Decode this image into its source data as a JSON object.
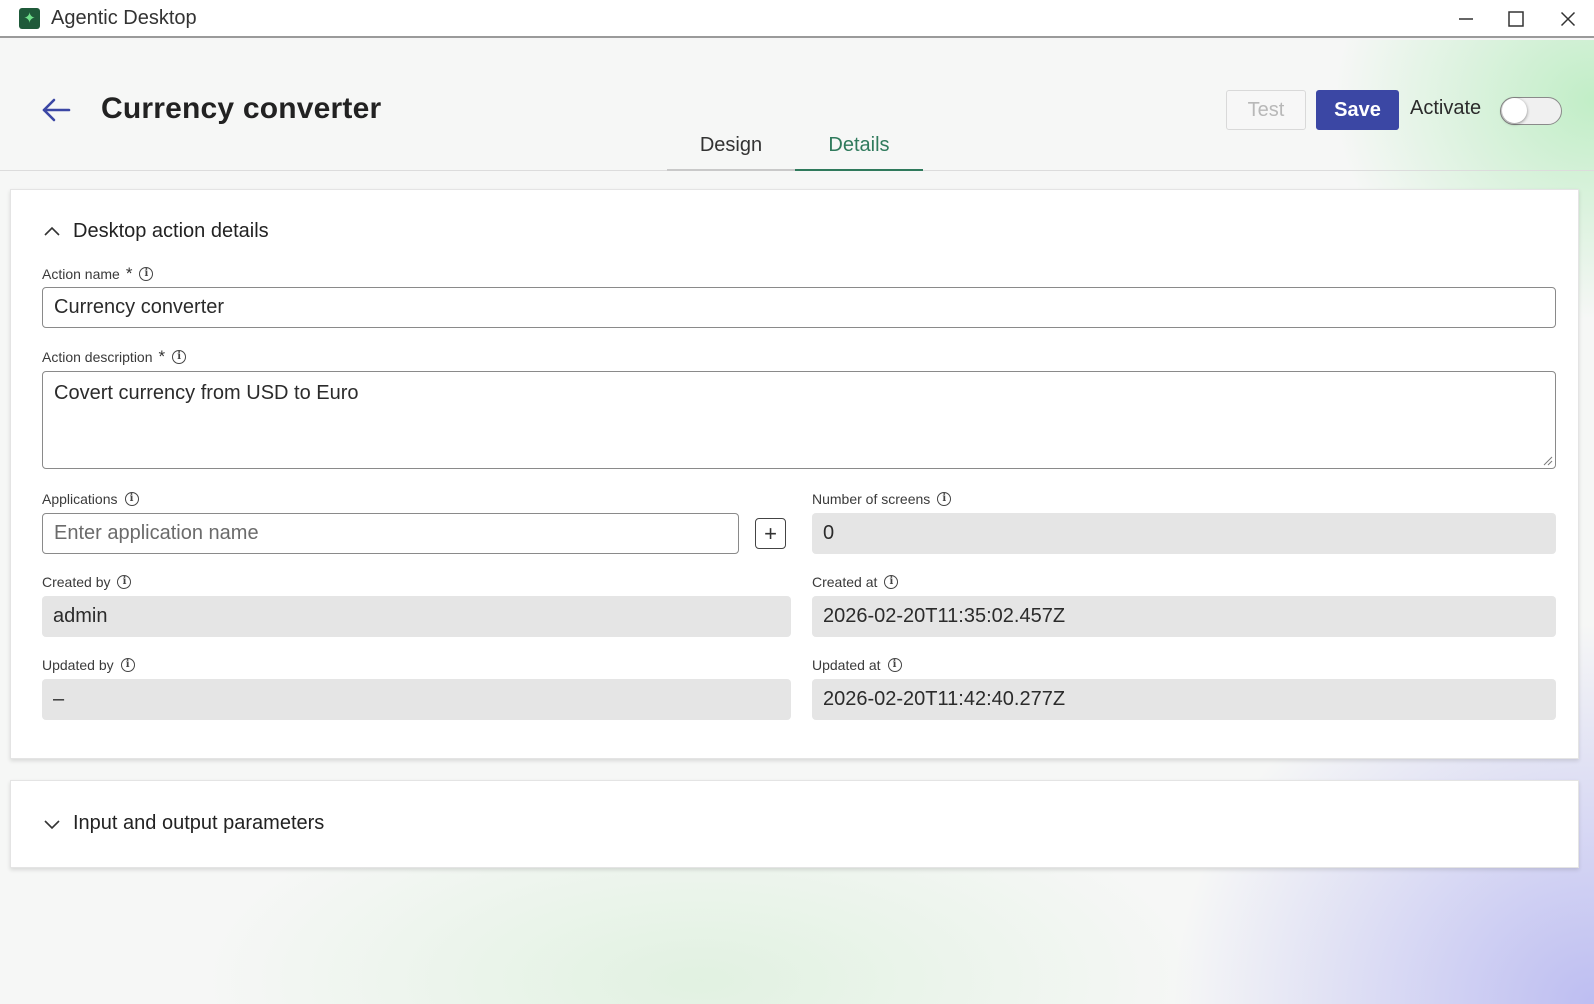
{
  "window": {
    "app_title": "Agentic Desktop",
    "logo_glyph": "✦"
  },
  "header": {
    "title": "Currency converter",
    "test_label": "Test",
    "save_label": "Save",
    "activate_label": "Activate",
    "activate_on": false
  },
  "tabs": [
    {
      "label": "Design",
      "active": false
    },
    {
      "label": "Details",
      "active": true
    }
  ],
  "details_section": {
    "title": "Desktop action details",
    "expanded": true,
    "action_name": {
      "label": "Action name",
      "required_mark": "*",
      "value": "Currency converter"
    },
    "action_description": {
      "label": "Action description",
      "required_mark": "*",
      "value": "Covert currency from USD to Euro"
    },
    "applications": {
      "label": "Applications",
      "placeholder": "Enter application name",
      "add_label": "+"
    },
    "number_of_screens": {
      "label": "Number of screens",
      "value": "0"
    },
    "created_by": {
      "label": "Created by",
      "value": "admin"
    },
    "created_at": {
      "label": "Created at",
      "value": "2026-02-20T11:35:02.457Z"
    },
    "updated_by": {
      "label": "Updated by",
      "value": "–"
    },
    "updated_at": {
      "label": "Updated at",
      "value": "2026-02-20T11:42:40.277Z"
    }
  },
  "io_section": {
    "title": "Input and output parameters",
    "expanded": false
  },
  "colors": {
    "primary": "#3b47a4",
    "tab_active": "#2f7a5c",
    "readonly_bg": "#e5e5e5"
  },
  "icons": {
    "back": "arrow-left-icon",
    "expanded": "chevron-up-icon",
    "collapsed": "chevron-down-icon",
    "info": "info-icon"
  }
}
